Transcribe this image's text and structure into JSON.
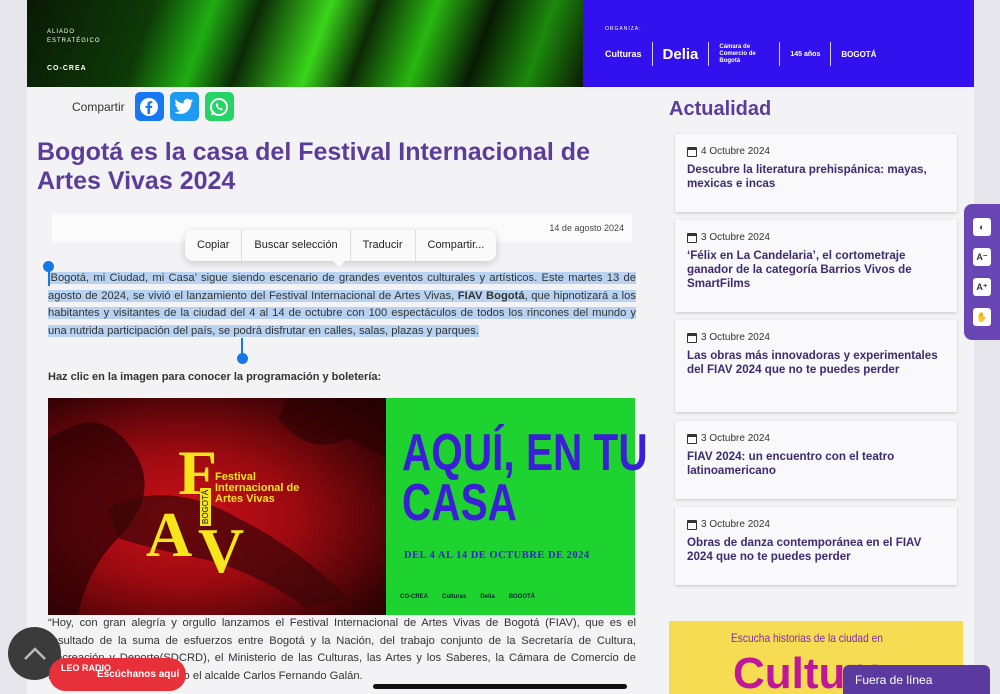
{
  "banner": {
    "aliado": "ALIADO ESTRATÉGICO",
    "cocrea": "CO-CREA",
    "organiza": "ORGANIZA:",
    "logos": [
      "Culturas",
      "Delia",
      "Cámara de Comercio de Bogotá",
      "145 años",
      "BOGOTÁ"
    ]
  },
  "share": {
    "label": "Compartir"
  },
  "article": {
    "title": "Bogotá es la casa del Festival Internacional de Artes Vivas 2024",
    "date": "14 de agosto 2024",
    "para_a": "‘Bogotá, mi Ciudad, mi Casa’ sigue siendo escenario de grandes eventos culturales y artísticos. Este martes 13 de agosto de 2024, se vivió el lanzamiento del Festival Internacional de Artes Vivas, ",
    "para_bold": "FIAV Bogotá",
    "para_b": ", que hipnotizará a los habitantes y visitantes de la ciudad del 4 al 14 de octubre con 100 espectáculos de todos los rincones del mundo y una nutrida participación del país, se podrá disfrutar en calles, salas, plazas y parques.",
    "instruction": "Haz clic en la imagen para conocer la programación y boletería:",
    "quote": "“Hoy, con gran alegría y orgullo lanzamos el Festival Internacional de Artes Vivas de Bogotá (FIAV), que es el resultado de la suma de esfuerzos entre Bogotá y la Nación, del trabajo conjunto de la Secretaría de Cultura, Recreación y Deporte(SDCRD), el Ministerio de las Culturas, las Artes y los Saberes, la Cámara de Comercio de Bogotá(CCB) y Cocrea”, dijo el alcalde Carlos Fernando Galán."
  },
  "context_menu": [
    "Copiar",
    "Buscar selección",
    "Traducir",
    "Compartir..."
  ],
  "poster": {
    "festival": "Festival Internacional de Artes Vivas",
    "bogota": "BOGOTÁ",
    "headline": "AQUÍ, EN TU CASA",
    "dates": "DEL 4 AL 14 DE OCTUBRE DE 2024"
  },
  "sidebar": {
    "title": "Actualidad",
    "cards": [
      {
        "date": "4 Octubre 2024",
        "headline": "Descubre la literatura prehispánica: mayas, mexicas e incas"
      },
      {
        "date": "3 Octubre 2024",
        "headline": "‘Félix en La Candelaria’, el cortometraje ganador de la categoría Barrios Vivos de SmartFilms"
      },
      {
        "date": "3 Octubre 2024",
        "headline": "Las obras más innovadoras y experimentales del FIAV 2024 que no te puedes perder"
      },
      {
        "date": "3 Octubre 2024",
        "headline": "FIAV 2024: un encuentro con el teatro latinoamericano"
      },
      {
        "date": "3 Octubre 2024",
        "headline": "Obras de danza contemporánea en el FIAV 2024 que no te puedes perder"
      }
    ]
  },
  "promo": {
    "text": "Escucha historias de la ciudad en",
    "big": "Cultura"
  },
  "offline": "Fuera de línea",
  "radio": {
    "logo": "LEO RADIO",
    "label": "Escúchanos aquí"
  },
  "colors": {
    "accent": "#5b3d99",
    "banner_blue": "#3311ee",
    "poster_green": "#1ed230",
    "radio_red": "#e8303a",
    "selection": "#b8d3f1"
  }
}
